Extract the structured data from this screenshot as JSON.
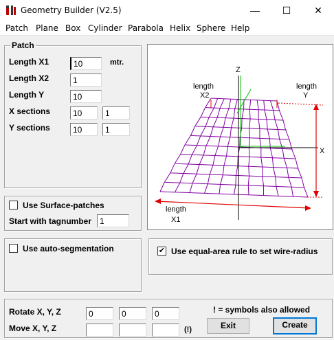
{
  "window": {
    "title": "Geometry Builder (V2.5)"
  },
  "menu": [
    "Patch",
    "Plane",
    "Box",
    "Cylinder",
    "Parabola",
    "Helix",
    "Sphere",
    "Help"
  ],
  "patch": {
    "legend": "Patch",
    "length_x1_label": "Length X1",
    "length_x1_value": "10",
    "length_x1_unit": "mtr.",
    "length_x2_label": "Length X2",
    "length_x2_value": "1",
    "length_y_label": "Length Y",
    "length_y_value": "10",
    "x_sections_label": "X sections",
    "x_sections_value_1": "10",
    "x_sections_value_2": "1",
    "y_sections_label": "Y sections",
    "y_sections_value_1": "10",
    "y_sections_value_2": "1"
  },
  "surface": {
    "use_surface_patches_label": "Use Surface-patches",
    "use_surface_patches_checked": false,
    "start_tag_label": "Start with tagnumber",
    "start_tag_value": "1"
  },
  "auto_seg": {
    "label": "Use auto-segmentation",
    "checked": false
  },
  "equal_area": {
    "label": "Use equal-area rule to set wire-radius",
    "checked": true,
    "check_glyph": "✔"
  },
  "diagram": {
    "z_label": "Z",
    "x_label": "X",
    "length_x2_line1": "length",
    "length_x2_line2": "X2",
    "length_y_line1": "length",
    "length_y_line2": "Y",
    "length_x1_line1": "length",
    "length_x1_line2": "X1",
    "grid_color": "#8000a0",
    "dim_color": "#e00000",
    "axis_color": "#00c000"
  },
  "transform": {
    "rotate_label": "Rotate X, Y, Z",
    "rotate_x": "0",
    "rotate_y": "0",
    "rotate_z": "0",
    "move_label": "Move X, Y, Z",
    "move_x": "",
    "move_y": "",
    "move_z": "",
    "move_hint": "(!)",
    "symbols_note": "! =  symbols also allowed",
    "exit_label": "Exit",
    "create_label": "Create"
  },
  "icons": {
    "minimize": "—",
    "maximize": "☐",
    "close": "✕"
  }
}
